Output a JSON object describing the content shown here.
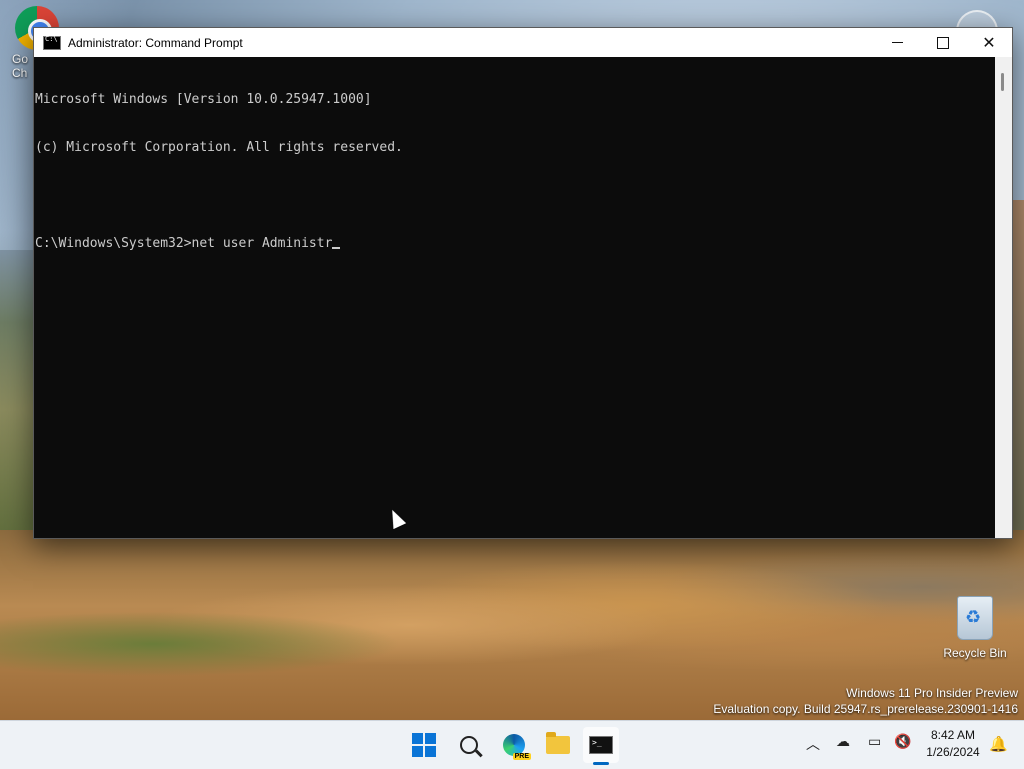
{
  "desktop": {
    "icons": [
      {
        "label_line1": "Go",
        "label_line2": "Ch"
      },
      {
        "label": "Recycle Bin"
      }
    ],
    "watermark": {
      "line1": "Windows 11 Pro Insider Preview",
      "line2": "Evaluation copy. Build 25947.rs_prerelease.230901-1416"
    }
  },
  "window": {
    "title": "Administrator: Command Prompt",
    "controls": {
      "minimize": "minimize",
      "maximize": "maximize",
      "close": "close"
    }
  },
  "console": {
    "lines": [
      "Microsoft Windows [Version 10.0.25947.1000]",
      "(c) Microsoft Corporation. All rights reserved.",
      "",
      "C:\\Windows\\System32>net user Administr"
    ]
  },
  "taskbar": {
    "apps": [
      "start-icon",
      "search-icon",
      "edge-icon",
      "file-explorer-icon",
      "command-prompt-icon"
    ],
    "edge_badge": "PRE",
    "clock": {
      "time": "8:42 AM",
      "date": "1/26/2024"
    }
  }
}
